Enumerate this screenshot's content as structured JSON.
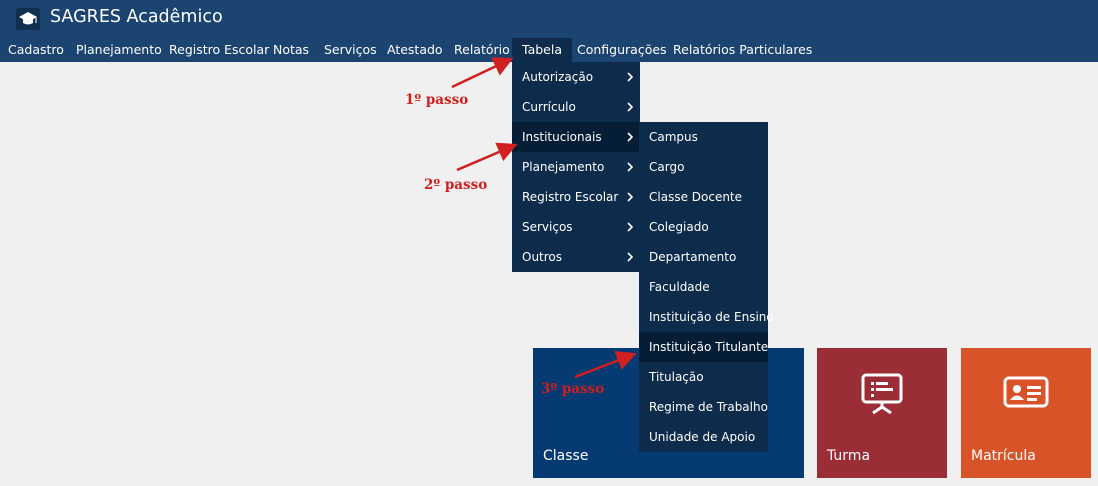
{
  "app": {
    "title": "SAGRES Acadêmico"
  },
  "nav": [
    "Cadastro",
    "Planejamento",
    "Registro Escolar",
    "Notas",
    "Serviços",
    "Atestado",
    "Relatório",
    "Tabela",
    "Configurações",
    "Relatórios Particulares"
  ],
  "tabela_menu": [
    "Autorização",
    "Currículo",
    "Institucionais",
    "Planejamento",
    "Registro Escolar",
    "Serviços",
    "Outros"
  ],
  "institucionais_menu": [
    "Campus",
    "Cargo",
    "Classe Docente",
    "Colegiado",
    "Departamento",
    "Faculdade",
    "Instituição de Ensino",
    "Instituição Titulante",
    "Titulação",
    "Regime de Trabalho",
    "Unidade de Apoio"
  ],
  "tiles": [
    {
      "label": "Classe",
      "color": "#063a72"
    },
    {
      "label": "Turma",
      "color": "#9a2d35"
    },
    {
      "label": "Matrícula",
      "color": "#d95329"
    }
  ],
  "annotations": {
    "step1": "1º passo",
    "step2": "2º passo",
    "step3": "3º passo",
    "color": "#d11e1e"
  },
  "colors": {
    "header": "#1b4470",
    "menu": "#0d2b4a",
    "menu_highlight": "#061d36",
    "background": "#f0f0f0"
  }
}
